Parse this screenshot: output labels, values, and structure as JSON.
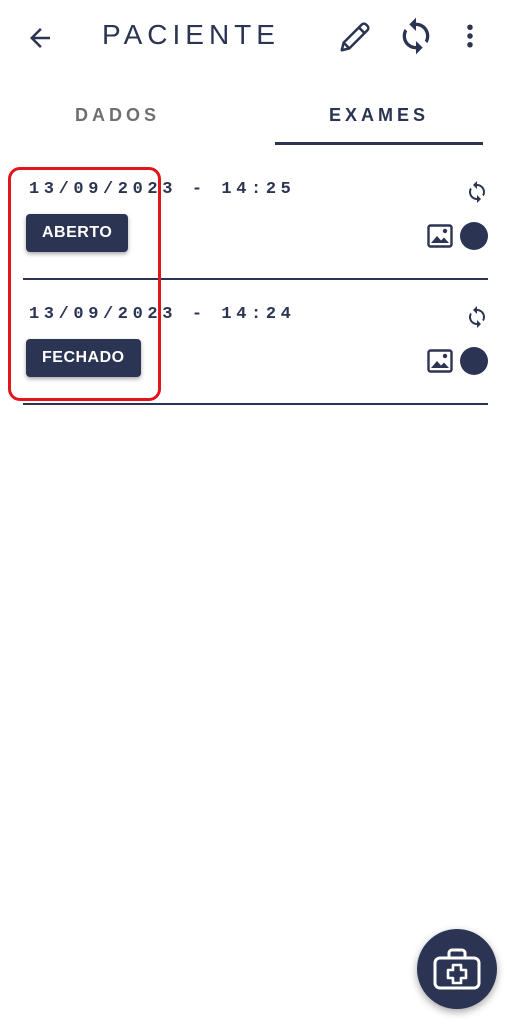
{
  "app_bar": {
    "title": "PACIENTE",
    "back_icon": "arrow-left-icon",
    "edit_icon": "pencil-icon",
    "sync_icon": "sync-icon",
    "more_icon": "more-vertical-icon"
  },
  "tabs": [
    {
      "label": "DADOS",
      "selected": false
    },
    {
      "label": "EXAMES",
      "selected": true
    }
  ],
  "exams": [
    {
      "datetime": "13/09/2023 - 14:25",
      "status": "ABERTO",
      "icons": [
        "sync-icon",
        "image-icon",
        "status-dot"
      ]
    },
    {
      "datetime": "13/09/2023 - 14:24",
      "status": "FECHADO",
      "icons": [
        "sync-icon",
        "image-icon",
        "status-dot"
      ]
    }
  ],
  "fab": {
    "icon": "medical-kit-icon"
  },
  "colors": {
    "primary": "#2b3452",
    "inactive_tab": "#6f6f6f",
    "highlight": "#e0161d",
    "background": "#ffffff"
  }
}
